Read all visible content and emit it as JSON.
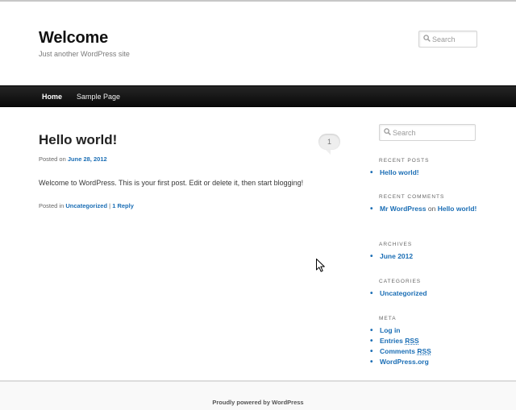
{
  "header": {
    "site_title": "Welcome",
    "site_description": "Just another WordPress site",
    "search_placeholder": "Search"
  },
  "nav": {
    "items": [
      {
        "label": "Home",
        "current": true
      },
      {
        "label": "Sample Page",
        "current": false
      }
    ]
  },
  "post": {
    "title": "Hello world!",
    "comment_count": "1",
    "posted_on_label": "Posted on",
    "date": "June 28, 2012",
    "content": "Welcome to WordPress. This is your first post. Edit or delete it, then start blogging!",
    "posted_in_label": "Posted in",
    "category": "Uncategorized",
    "separator": "|",
    "reply_link": "1 Reply"
  },
  "sidebar": {
    "search_placeholder": "Search",
    "recent_posts": {
      "title": "Recent Posts",
      "items": [
        "Hello world!"
      ]
    },
    "recent_comments": {
      "title": "Recent Comments",
      "author": "Mr WordPress",
      "on": "on",
      "post": "Hello world!"
    },
    "archives": {
      "title": "Archives",
      "items": [
        "June 2012"
      ]
    },
    "categories": {
      "title": "Categories",
      "items": [
        "Uncategorized"
      ]
    },
    "meta": {
      "title": "Meta",
      "login": "Log in",
      "entries_prefix": "Entries",
      "comments_prefix": "Comments",
      "rss": "RSS",
      "wordpress_org": "WordPress.org"
    }
  },
  "footer": {
    "text": "Proudly powered by WordPress"
  },
  "colors": {
    "link": "#1b6eb5",
    "nav_bg": "#0a0a0a",
    "text": "#373737"
  }
}
